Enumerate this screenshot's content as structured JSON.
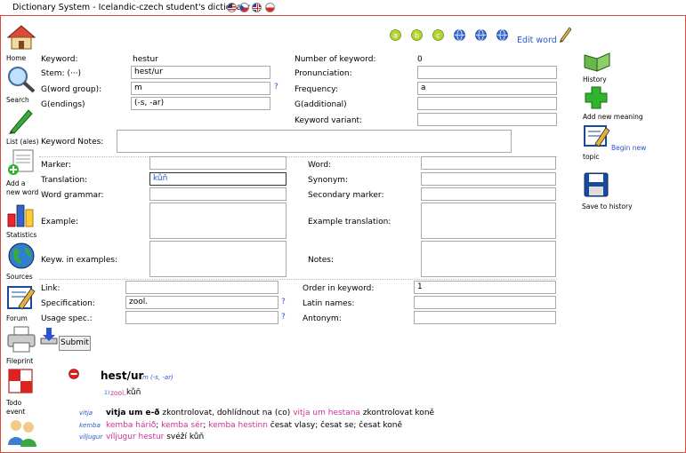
{
  "title": "Dictionary System - Icelandic-czech student's dictionary",
  "topbar": {
    "edit_word": "Edit word"
  },
  "nav": {
    "home": "Home",
    "search": "Search",
    "list": "List (ales)",
    "add_word_1": "Add a",
    "add_word_2": "new word",
    "statistics": "Statistics",
    "sources": "Sources",
    "forum": "Forum",
    "fileprint": "Fileprint",
    "todo_1": "Todo",
    "todo_2": "event"
  },
  "right": {
    "history": "History",
    "add_meaning": "Add new meaning",
    "begin_topic_1": "Begin new",
    "begin_topic_2": "topic",
    "save_history": "Save to history"
  },
  "form": {
    "keyword_label": "Keyword:",
    "keyword_value": "hestur",
    "stem_label": "Stem: (···)",
    "stem_value": "hest/ur",
    "gword_label": "G(word group):",
    "gword_value": "m",
    "gend_label": "G(endings)",
    "gend_value": "(-s, -ar)",
    "numkw_label": "Number of keyword:",
    "numkw_value": "0",
    "pron_label": "Pronunciation:",
    "pron_value": "",
    "freq_label": "Frequency:",
    "freq_value": "a",
    "gadd_label": "G(additional)",
    "gadd_value": "",
    "kwvar_label": "Keyword variant:",
    "kwvar_value": "",
    "kwnotes_label": "Keyword Notes:",
    "marker_label": "Marker:",
    "marker_value": "",
    "translation_label": "Translation:",
    "translation_value": "kůň",
    "wgrammar_label": "Word grammar:",
    "wgrammar_value": "",
    "example_label": "Example:",
    "kwex_label": "Keyw. in examples:",
    "word_label": "Word:",
    "word_value": "",
    "synonym_label": "Synonym:",
    "synonym_value": "",
    "secmarker_label": "Secondary marker:",
    "secmarker_value": "",
    "extrans_label": "Example translation:",
    "notes_label": "Notes:",
    "link_label": "Link:",
    "link_value": "",
    "spec_label": "Specification:",
    "spec_value": "zool.",
    "usage_label": "Usage spec.:",
    "usage_value": "",
    "order_label": "Order in keyword:",
    "order_value": "1",
    "latin_label": "Latin names:",
    "latin_value": "",
    "antonym_label": "Antonym:",
    "antonym_value": "",
    "q": "?",
    "submit": "Submit"
  },
  "preview": {
    "headword": "hest/ur",
    "grammar": "m (-s, -ar)",
    "sense_num": "1)",
    "sense_spec": "zool.",
    "sense_trans": "kůň",
    "examples": [
      {
        "tag": "vitja",
        "parts": [
          {
            "t": "vitja um e-ð",
            "c": "bold"
          },
          {
            "t": " zkontrolovat, dohlídnout na (co)",
            "c": "plain"
          },
          {
            "t": "  vitja um hestana",
            "c": "pink"
          },
          {
            "t": " zkontrolovat koně",
            "c": "plain"
          }
        ]
      },
      {
        "tag": "kemba",
        "parts": [
          {
            "t": "kemba hárið",
            "c": "pink"
          },
          {
            "t": "; ",
            "c": "plain"
          },
          {
            "t": "kemba sér",
            "c": "pink"
          },
          {
            "t": "; ",
            "c": "plain"
          },
          {
            "t": "kemba hestinn",
            "c": "pink"
          },
          {
            "t": " česat vlasy; česat se; česat koně",
            "c": "plain"
          }
        ]
      },
      {
        "tag": "víljugur",
        "parts": [
          {
            "t": "víljugur hestur",
            "c": "pink"
          },
          {
            "t": " svéží kůň",
            "c": "plain"
          }
        ]
      }
    ]
  },
  "colors": {
    "frame": "#d84a3a",
    "link": "#2a55cc",
    "example": "#cc3399",
    "add_green": "#2db52d"
  }
}
